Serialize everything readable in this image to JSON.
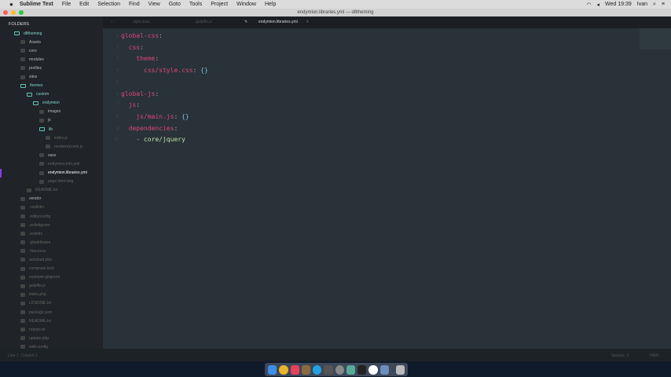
{
  "menubar": {
    "app": "Sublime Text",
    "items": [
      "File",
      "Edit",
      "Selection",
      "Find",
      "View",
      "Goto",
      "Tools",
      "Project",
      "Window",
      "Help"
    ],
    "clock": "Wed 19:39",
    "user": "Ivan"
  },
  "window": {
    "title": "endymion.libraries.yml — d8theming"
  },
  "sidebar": {
    "header": "FOLDERS",
    "items": [
      {
        "label": "d8theming",
        "depth": 0,
        "type": "open"
      },
      {
        "label": "Assets",
        "depth": 1,
        "type": "folder"
      },
      {
        "label": "core",
        "depth": 1,
        "type": "folder"
      },
      {
        "label": "modules",
        "depth": 1,
        "type": "folder"
      },
      {
        "label": "profiles",
        "depth": 1,
        "type": "folder"
      },
      {
        "label": "sites",
        "depth": 1,
        "type": "folder"
      },
      {
        "label": "themes",
        "depth": 1,
        "type": "open"
      },
      {
        "label": "custom",
        "depth": 2,
        "type": "open"
      },
      {
        "label": "endymion",
        "depth": 3,
        "type": "open"
      },
      {
        "label": "images",
        "depth": 4,
        "type": "folder"
      },
      {
        "label": "js",
        "depth": 4,
        "type": "folder"
      },
      {
        "label": "lib",
        "depth": 4,
        "type": "open"
      },
      {
        "label": "index.js",
        "depth": 5,
        "type": "dim"
      },
      {
        "label": "modernizr.min.js",
        "depth": 5,
        "type": "dim"
      },
      {
        "label": "sass",
        "depth": 4,
        "type": "folder"
      },
      {
        "label": "endymion.info.yml",
        "depth": 4,
        "type": "dim"
      },
      {
        "label": "endymion.libraries.yml",
        "depth": 4,
        "type": "sel"
      },
      {
        "label": "page.html.twig",
        "depth": 4,
        "type": "dim"
      },
      {
        "label": "README.txt",
        "depth": 2,
        "type": "dim"
      },
      {
        "label": "vendor",
        "depth": 1,
        "type": "folder"
      },
      {
        "label": ".csslintrc",
        "depth": 1,
        "type": "dim"
      },
      {
        "label": ".editorconfig",
        "depth": 1,
        "type": "dim"
      },
      {
        "label": ".eslintignore",
        "depth": 1,
        "type": "dim"
      },
      {
        "label": ".eslintrc",
        "depth": 1,
        "type": "dim"
      },
      {
        "label": ".gitattributes",
        "depth": 1,
        "type": "dim"
      },
      {
        "label": ".htaccess",
        "depth": 1,
        "type": "dim"
      },
      {
        "label": "autoload.php",
        "depth": 1,
        "type": "dim"
      },
      {
        "label": "composer.lock",
        "depth": 1,
        "type": "dim"
      },
      {
        "label": "example.gitignore",
        "depth": 1,
        "type": "dim"
      },
      {
        "label": "gulpfile.js",
        "depth": 1,
        "type": "dim"
      },
      {
        "label": "index.php",
        "depth": 1,
        "type": "dim"
      },
      {
        "label": "LICENSE.txt",
        "depth": 1,
        "type": "dim"
      },
      {
        "label": "package.json",
        "depth": 1,
        "type": "dim"
      },
      {
        "label": "README.txt",
        "depth": 1,
        "type": "dim"
      },
      {
        "label": "robots.txt",
        "depth": 1,
        "type": "dim"
      },
      {
        "label": "update.php",
        "depth": 1,
        "type": "dim"
      },
      {
        "label": "web.config",
        "depth": 1,
        "type": "dim"
      }
    ]
  },
  "tabs": [
    {
      "label": "style.scss"
    },
    {
      "label": "gulpfile.js"
    },
    {
      "label": "endymion.libraries.yml",
      "active": true
    }
  ],
  "editor": {
    "lines": [
      [
        [
          "k",
          "global-css"
        ],
        [
          "c",
          ":"
        ]
      ],
      [
        [
          "c",
          "  "
        ],
        [
          "k",
          "css"
        ],
        [
          "c",
          ":"
        ]
      ],
      [
        [
          "c",
          "    "
        ],
        [
          "k",
          "theme"
        ],
        [
          "c",
          ":"
        ]
      ],
      [
        [
          "c",
          "      "
        ],
        [
          "k",
          "css/style.css"
        ],
        [
          "c",
          ": "
        ],
        [
          "p",
          "{}"
        ]
      ],
      [],
      [
        [
          "k",
          "global-js"
        ],
        [
          "c",
          ":"
        ]
      ],
      [
        [
          "c",
          "  "
        ],
        [
          "k",
          "js"
        ],
        [
          "c",
          ":"
        ]
      ],
      [
        [
          "c",
          "    "
        ],
        [
          "k",
          "js/main.js"
        ],
        [
          "c",
          ": "
        ],
        [
          "p",
          "{}"
        ]
      ],
      [
        [
          "c",
          "  "
        ],
        [
          "k",
          "dependencies"
        ],
        [
          "c",
          ":"
        ]
      ],
      [
        [
          "c",
          "    - "
        ],
        [
          "s",
          "core/jquery"
        ]
      ]
    ]
  },
  "status": {
    "left": "Line 1, Column 1",
    "spaces": "Spaces: 2",
    "syntax": "YAML"
  }
}
